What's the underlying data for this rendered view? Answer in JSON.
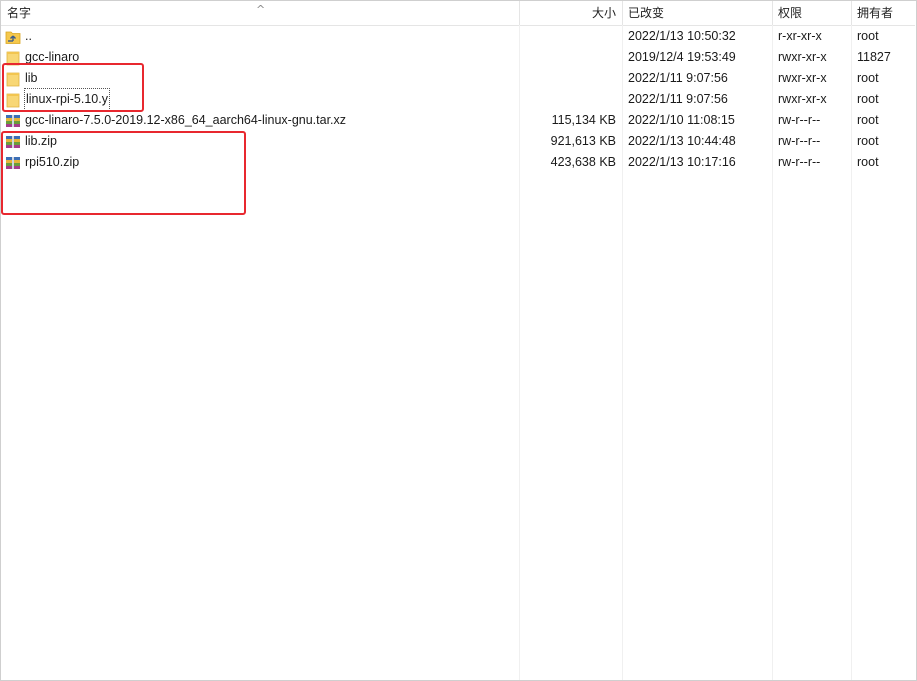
{
  "columns": {
    "name": "名字",
    "size": "大小",
    "modified": "已改变",
    "permissions": "权限",
    "owner": "拥有者"
  },
  "files": [
    {
      "icon": "parent-folder-icon",
      "name": "..",
      "size": "",
      "modified": "2022/1/13 10:50:32",
      "permissions": "r-xr-xr-x",
      "owner": "root"
    },
    {
      "icon": "folder-icon",
      "name": "gcc-linaro",
      "size": "",
      "modified": "2019/12/4 19:53:49",
      "permissions": "rwxr-xr-x",
      "owner": "11827"
    },
    {
      "icon": "folder-icon",
      "name": "lib",
      "size": "",
      "modified": "2022/1/11 9:07:56",
      "permissions": "rwxr-xr-x",
      "owner": "root"
    },
    {
      "icon": "folder-icon",
      "name": "linux-rpi-5.10.y",
      "size": "",
      "modified": "2022/1/11 9:07:56",
      "permissions": "rwxr-xr-x",
      "owner": "root"
    },
    {
      "icon": "archive-icon",
      "name": "gcc-linaro-7.5.0-2019.12-x86_64_aarch64-linux-gnu.tar.xz",
      "size": "115,134 KB",
      "modified": "2022/1/10 11:08:15",
      "permissions": "rw-r--r--",
      "owner": "root"
    },
    {
      "icon": "archive-icon",
      "name": "lib.zip",
      "size": "921,613 KB",
      "modified": "2022/1/13 10:44:48",
      "permissions": "rw-r--r--",
      "owner": "root"
    },
    {
      "icon": "archive-icon",
      "name": "rpi510.zip",
      "size": "423,638 KB",
      "modified": "2022/1/13 10:17:16",
      "permissions": "rw-r--r--",
      "owner": "root"
    }
  ],
  "colors": {
    "highlight": "#e8282f",
    "folder": "#f5c84c"
  }
}
